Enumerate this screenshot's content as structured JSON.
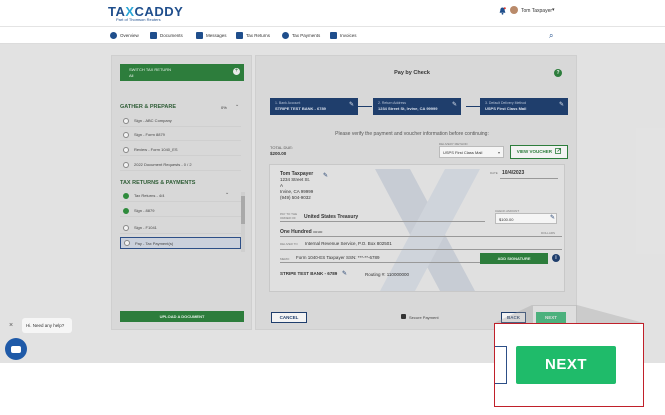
{
  "brand": {
    "logo_a": "TA",
    "logo_x": "X",
    "logo_b": "CADDY",
    "tagline": "Part of Thomson Reuters"
  },
  "header": {
    "user_name": "Tom Taxpayer",
    "bell_icon": "bell-icon",
    "chevron": "▾"
  },
  "nav": {
    "items": [
      {
        "label": "Overview"
      },
      {
        "label": "Documents"
      },
      {
        "label": "Messages"
      },
      {
        "label": "Tax Returns"
      },
      {
        "label": "Tax Payments"
      },
      {
        "label": "Invoices"
      }
    ],
    "search_icon": "⌕"
  },
  "left_panel": {
    "switch_label": "SWITCH TAX RETURN",
    "switch_value": "All",
    "switch_plus": "+",
    "gather_title": "GATHER & PREPARE",
    "gather_pct": "0%",
    "gather_progress": 0,
    "gather_tasks": [
      {
        "label": "Sign - ABC Company",
        "done": false
      },
      {
        "label": "Sign - Form 8879",
        "done": false
      },
      {
        "label": "Review - Form 1040_ES",
        "done": false
      },
      {
        "label": "2022 Document Requests - 0 / 2",
        "done": false
      }
    ],
    "returns_title": "TAX RETURNS & PAYMENTS",
    "return_tasks": [
      {
        "label": "Tax Returns - 4/4",
        "done": true
      },
      {
        "label": "Sign - 8879",
        "done": true
      },
      {
        "label": "Sign - F1041",
        "done": false
      },
      {
        "label": "Pay - Tax Payment(s)",
        "done": false,
        "active": true
      }
    ],
    "upload_label": "UPLOAD A DOCUMENT",
    "caret": "⌄"
  },
  "main": {
    "title": "Pay by Check",
    "help_icon": "?",
    "steps": [
      {
        "key": "1. Bank Account",
        "value": "STRIPE TEST BANK - 6789"
      },
      {
        "key": "2. Return Address",
        "value": "1234 Street St, Irvine, CA 99999"
      },
      {
        "key": "3. Default Delivery Method",
        "value": "USPS First Class Mail"
      }
    ],
    "pen": "✎",
    "verify_text": "Please verify the payment and voucher information before continuing:",
    "total_due_label": "TOTAL DUE:",
    "total_due_value": "$200.00",
    "delivery_label": "DELIVERY METHOD",
    "delivery_value": "USPS First Class Mail",
    "dropdown": "▾",
    "view_voucher": "VIEW VOUCHER",
    "check": {
      "payer_name": "Tom Taxpayer",
      "payer_lines": [
        "1234 Street St.",
        "A",
        "Irvine, CA 99999",
        "(949) 504-9032"
      ],
      "date_label": "DATE",
      "date_value": "10/4/2023",
      "pay_to_label": "PAY TO THE ORDER OF",
      "pay_to_value": "United States Treasury",
      "amount_label": "CHECK AMOUNT",
      "amount_value": "$100.00",
      "words": "One Hundred",
      "words_cents": "00/100",
      "dollars_label": "DOLLARS",
      "deliver_to_label": "DELIVER TO",
      "deliver_to_value": "Internal Revenue Service, P.O. Box 802501",
      "memo_label": "MEMO",
      "memo_value": "Form 1040-ES    Taxpayer SSN: ***-**-6789",
      "add_signature": "ADD SIGNATURE",
      "info_icon": "i",
      "bank_name": "STRIPE TEST BANK - 6789",
      "routing": "Routing #: 110000000"
    },
    "cancel": "CANCEL",
    "secure": "Secure Payment",
    "back": "BACK",
    "next": "NEXT"
  },
  "chat": {
    "close": "×",
    "prompt": "Hi. Need any help?"
  },
  "zoom": {
    "next": "NEXT"
  },
  "colors": {
    "brand_blue": "#1f4e8c",
    "brand_green": "#2d7d3c",
    "next_green": "#1fbb6a",
    "callout_red": "#c0202a"
  }
}
